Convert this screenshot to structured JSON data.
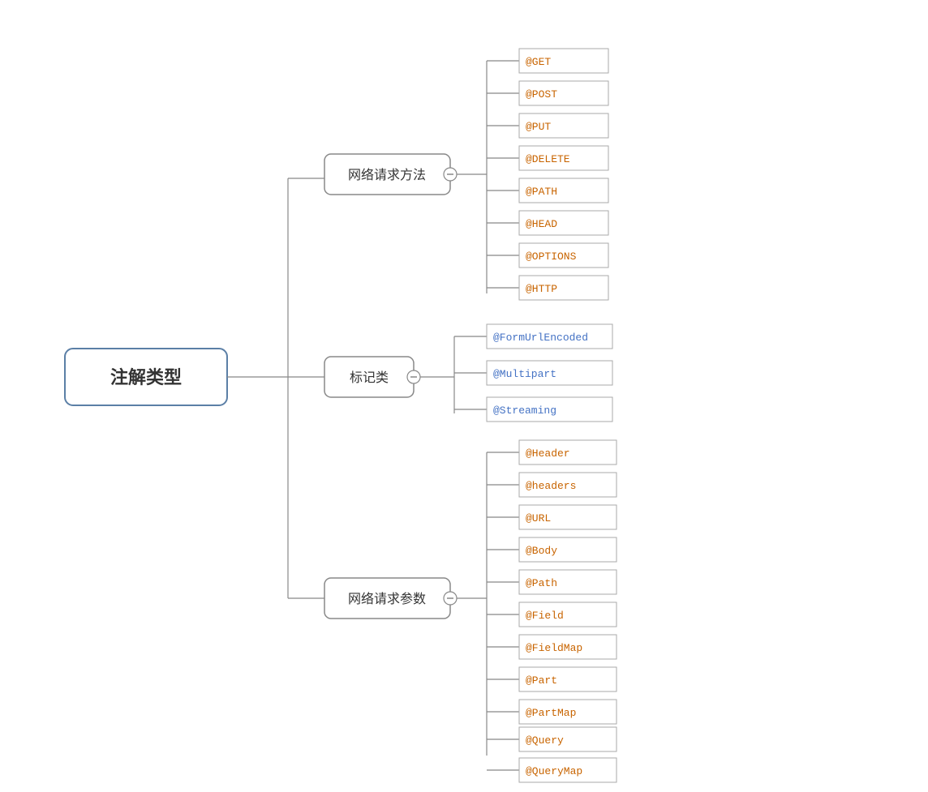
{
  "diagram": {
    "title": "注解类型",
    "branches": [
      {
        "id": "branch1",
        "label": "网络请求方法",
        "leaves": [
          {
            "text": "@GET",
            "color": "orange"
          },
          {
            "text": "@POST",
            "color": "orange"
          },
          {
            "text": "@PUT",
            "color": "orange"
          },
          {
            "text": "@DELETE",
            "color": "orange"
          },
          {
            "text": "@PATH",
            "color": "orange"
          },
          {
            "text": "@HEAD",
            "color": "orange"
          },
          {
            "text": "@OPTIONS",
            "color": "orange"
          },
          {
            "text": "@HTTP",
            "color": "orange"
          }
        ]
      },
      {
        "id": "branch2",
        "label": "标记类",
        "leaves": [
          {
            "text": "@FormUrlEncoded",
            "color": "blue"
          },
          {
            "text": "@Multipart",
            "color": "blue"
          },
          {
            "text": "@Streaming",
            "color": "blue"
          }
        ]
      },
      {
        "id": "branch3",
        "label": "网络请求参数",
        "leaves": [
          {
            "text": "@Header",
            "color": "orange"
          },
          {
            "text": "@headers",
            "color": "orange"
          },
          {
            "text": "@URL",
            "color": "orange"
          },
          {
            "text": "@Body",
            "color": "orange"
          },
          {
            "text": "@Path",
            "color": "orange"
          },
          {
            "text": "@Field",
            "color": "orange"
          },
          {
            "text": "@FieldMap",
            "color": "orange"
          },
          {
            "text": "@Part",
            "color": "orange"
          },
          {
            "text": "@PartMap",
            "color": "orange"
          },
          {
            "text": "@Query",
            "color": "orange"
          },
          {
            "text": "@QueryMap",
            "color": "orange"
          }
        ]
      }
    ]
  }
}
